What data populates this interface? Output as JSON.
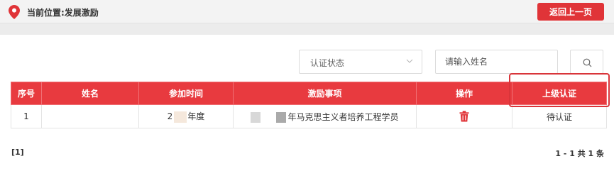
{
  "breadcrumb": {
    "label": "当前位置:发展激励"
  },
  "back_button": {
    "label": "返回上一页"
  },
  "filters": {
    "status_placeholder": "认证状态",
    "name_placeholder": "请输入姓名"
  },
  "table": {
    "headers": [
      "序号",
      "姓名",
      "参加时间",
      "激励事项",
      "操作",
      "上级认证"
    ],
    "rows": [
      {
        "index": "1",
        "name": "",
        "date_prefix": "2",
        "date_suffix": "年度",
        "item": "年马克思主义者培养工程学员",
        "status": "待认证"
      }
    ]
  },
  "pagination": {
    "pages": "[1]",
    "summary": "1 - 1  共 1 条"
  },
  "colors": {
    "accent": "#e83a3f",
    "button": "#e03438",
    "highlight": "#d9353a"
  },
  "icons": {
    "location": "location-pin-icon",
    "chevron": "chevron-down-icon",
    "search": "search-icon",
    "delete": "trash-icon"
  }
}
